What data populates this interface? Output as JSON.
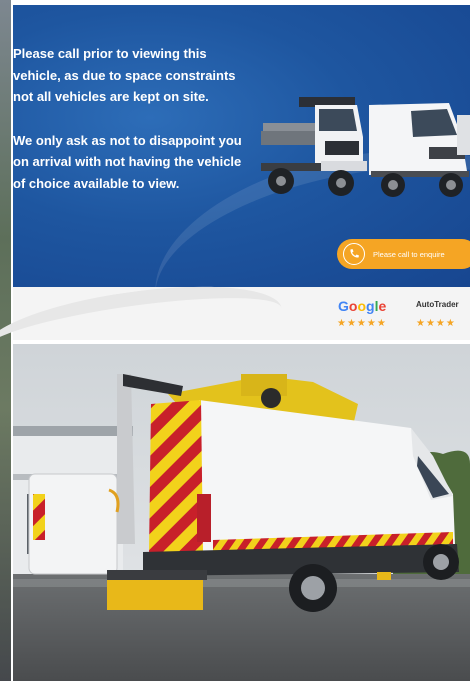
{
  "banner": {
    "paragraph_1": "Please call prior to viewing this vehicle, as due to space constraints not all vehicles are kept on site.",
    "paragraph_2": "We only ask as not to disappoint you on arrival with not having the vehicle of choice available to view.",
    "cta_label": "Please call to enquire",
    "cta_icon": "phone-icon"
  },
  "reviews": {
    "google_label": "Google",
    "google_stars": "★★★★★",
    "autotrader_label": "AutoTrader",
    "autotrader_stars": "★★★★"
  },
  "photo": {
    "subject": "white-van-with-access-platform"
  },
  "colors": {
    "banner_blue": "#1e56a0",
    "cta_orange": "#f5a524",
    "chevron_red": "#c8202a",
    "chevron_yellow": "#f2d21b"
  }
}
